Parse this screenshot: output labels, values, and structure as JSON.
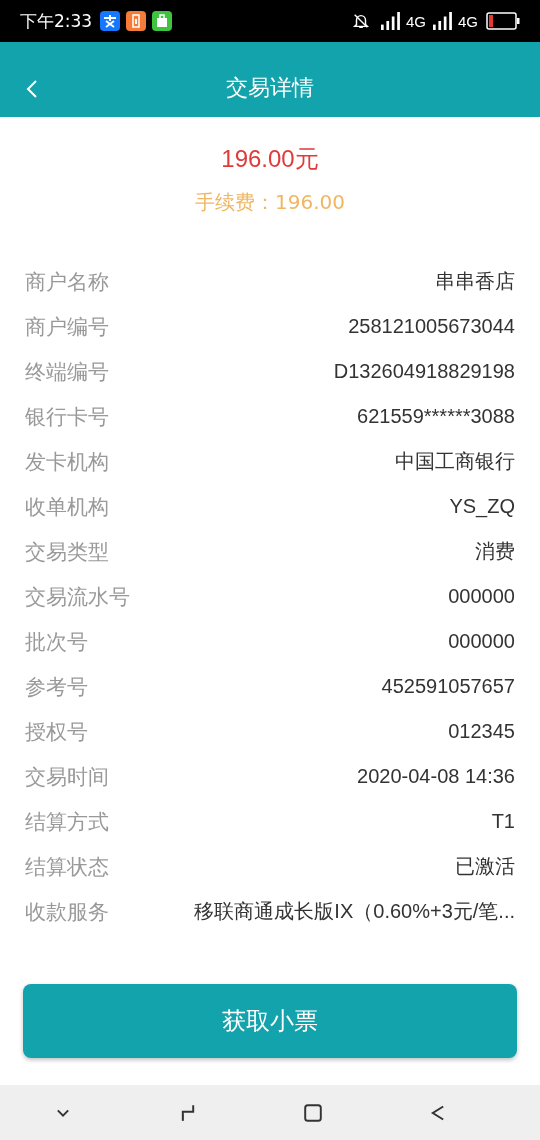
{
  "status_bar": {
    "time": "下午2:33",
    "network_1": "4G",
    "network_2": "4G"
  },
  "header": {
    "title": "交易详情"
  },
  "summary": {
    "amount": "196.00元",
    "fee": "手续费：196.00"
  },
  "rows": [
    {
      "label": "商户名称",
      "value": "串串香店"
    },
    {
      "label": "商户编号",
      "value": "258121005673044"
    },
    {
      "label": "终端编号",
      "value": "D132604918829198"
    },
    {
      "label": "银行卡号",
      "value": "621559******3088"
    },
    {
      "label": "发卡机构",
      "value": "中国工商银行"
    },
    {
      "label": "收单机构",
      "value": "YS_ZQ"
    },
    {
      "label": "交易类型",
      "value": "消费"
    },
    {
      "label": "交易流水号",
      "value": "000000"
    },
    {
      "label": "批次号",
      "value": "000000"
    },
    {
      "label": "参考号",
      "value": "452591057657"
    },
    {
      "label": "授权号",
      "value": "012345"
    },
    {
      "label": "交易时间",
      "value": "2020-04-08 14:36"
    },
    {
      "label": "结算方式",
      "value": "T1"
    },
    {
      "label": "结算状态",
      "value": "已激活"
    },
    {
      "label": "收款服务",
      "value": "移联商通成长版IX（0.60%+3元/笔..."
    }
  ],
  "button": {
    "label": "获取小票"
  }
}
